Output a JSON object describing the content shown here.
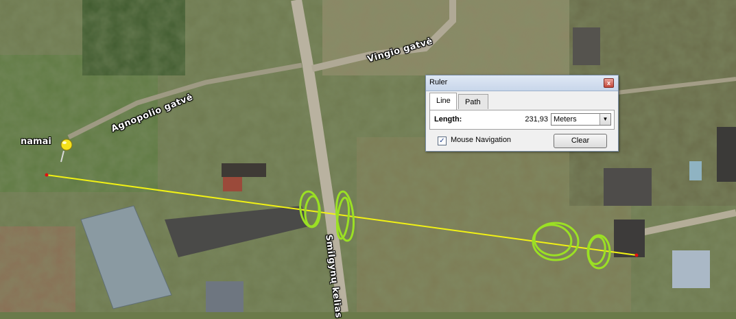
{
  "map": {
    "streets": [
      "Vingio gatvė",
      "Agnopolio gatvė",
      "Smilgynų kelias"
    ],
    "placemark": {
      "label": "namai",
      "icon": "pushpin-icon",
      "color": "#f5e21b"
    },
    "ruler_line_color": "#f2f214",
    "annotation_color": "#9be024"
  },
  "ruler": {
    "title": "Ruler",
    "close_label": "x",
    "tabs": [
      {
        "label": "Line",
        "active": true
      },
      {
        "label": "Path",
        "active": false
      }
    ],
    "length_label": "Length:",
    "length_value": "231,93",
    "unit_value": "Meters",
    "unit_arrow": "▼",
    "mouse_navigation_label": "Mouse Navigation",
    "mouse_navigation_checked": true,
    "check_mark": "✓",
    "clear_label": "Clear"
  }
}
